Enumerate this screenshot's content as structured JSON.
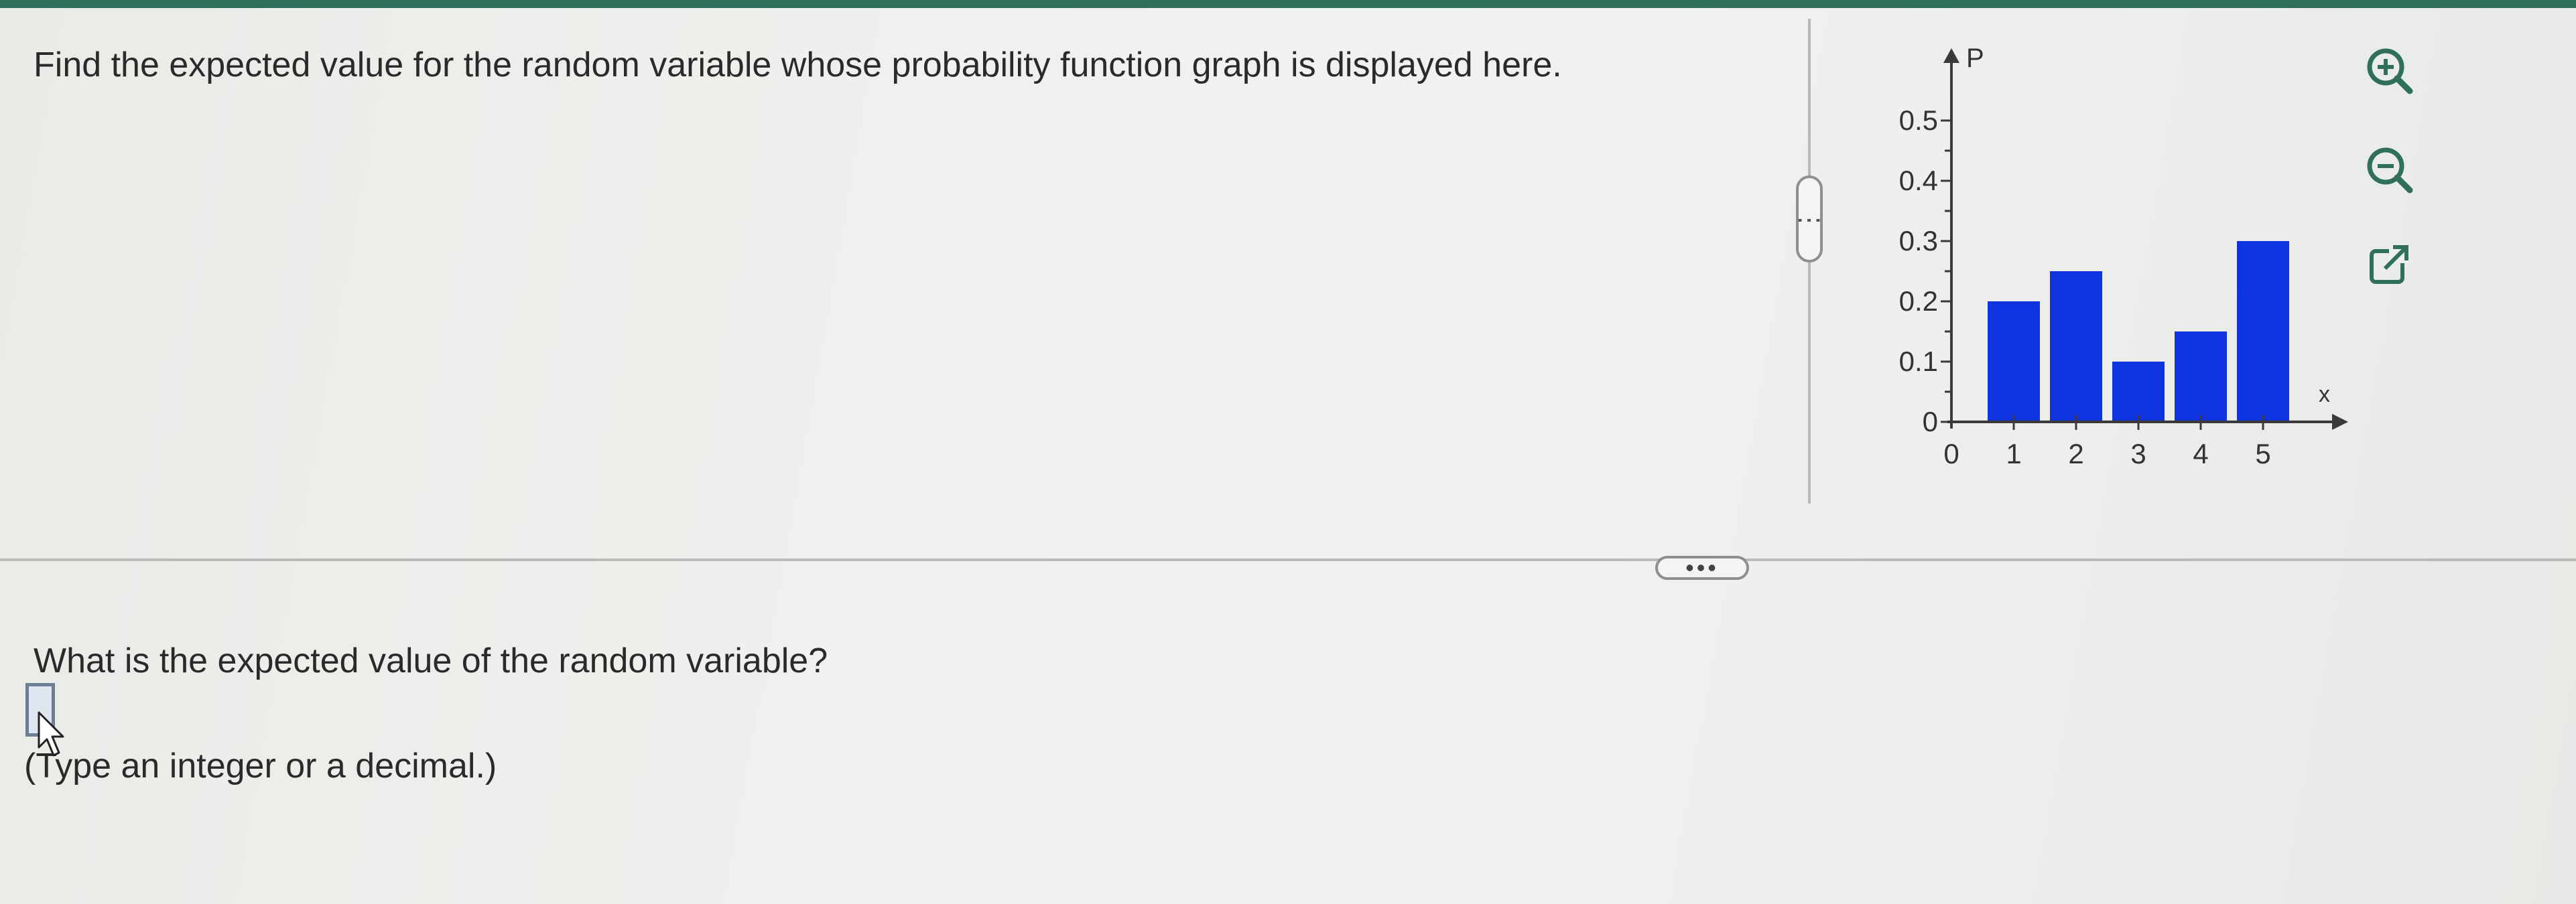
{
  "question": {
    "text": "Find the expected value for the random variable whose probability function graph is displayed here."
  },
  "prompt": {
    "text": "What is the expected value of the random variable?",
    "answer_value": "",
    "hint": "(Type an integer or a decimal.)"
  },
  "toolbar": {
    "zoom_in_icon": "zoom-in-icon",
    "zoom_out_icon": "zoom-out-icon",
    "popout_icon": "popout-icon",
    "icon_color": "#2f6f5b"
  },
  "dividers": {
    "vertical_handle": "⋮",
    "horizontal_handle": "•••"
  },
  "chart_data": {
    "type": "bar",
    "ylabel": "P",
    "xlabel": "x",
    "x_ticks": [
      "0",
      "1",
      "2",
      "3",
      "4",
      "5"
    ],
    "y_ticks": [
      "0",
      "0.1",
      "0.2",
      "0.3",
      "0.4",
      "0.5"
    ],
    "ylim": [
      0,
      0.5
    ],
    "xlim": [
      0,
      5
    ],
    "categories": [
      1,
      2,
      3,
      4,
      5
    ],
    "values": [
      0.2,
      0.25,
      0.1,
      0.15,
      0.3
    ],
    "bar_color": "#1033e0",
    "grid": false
  }
}
